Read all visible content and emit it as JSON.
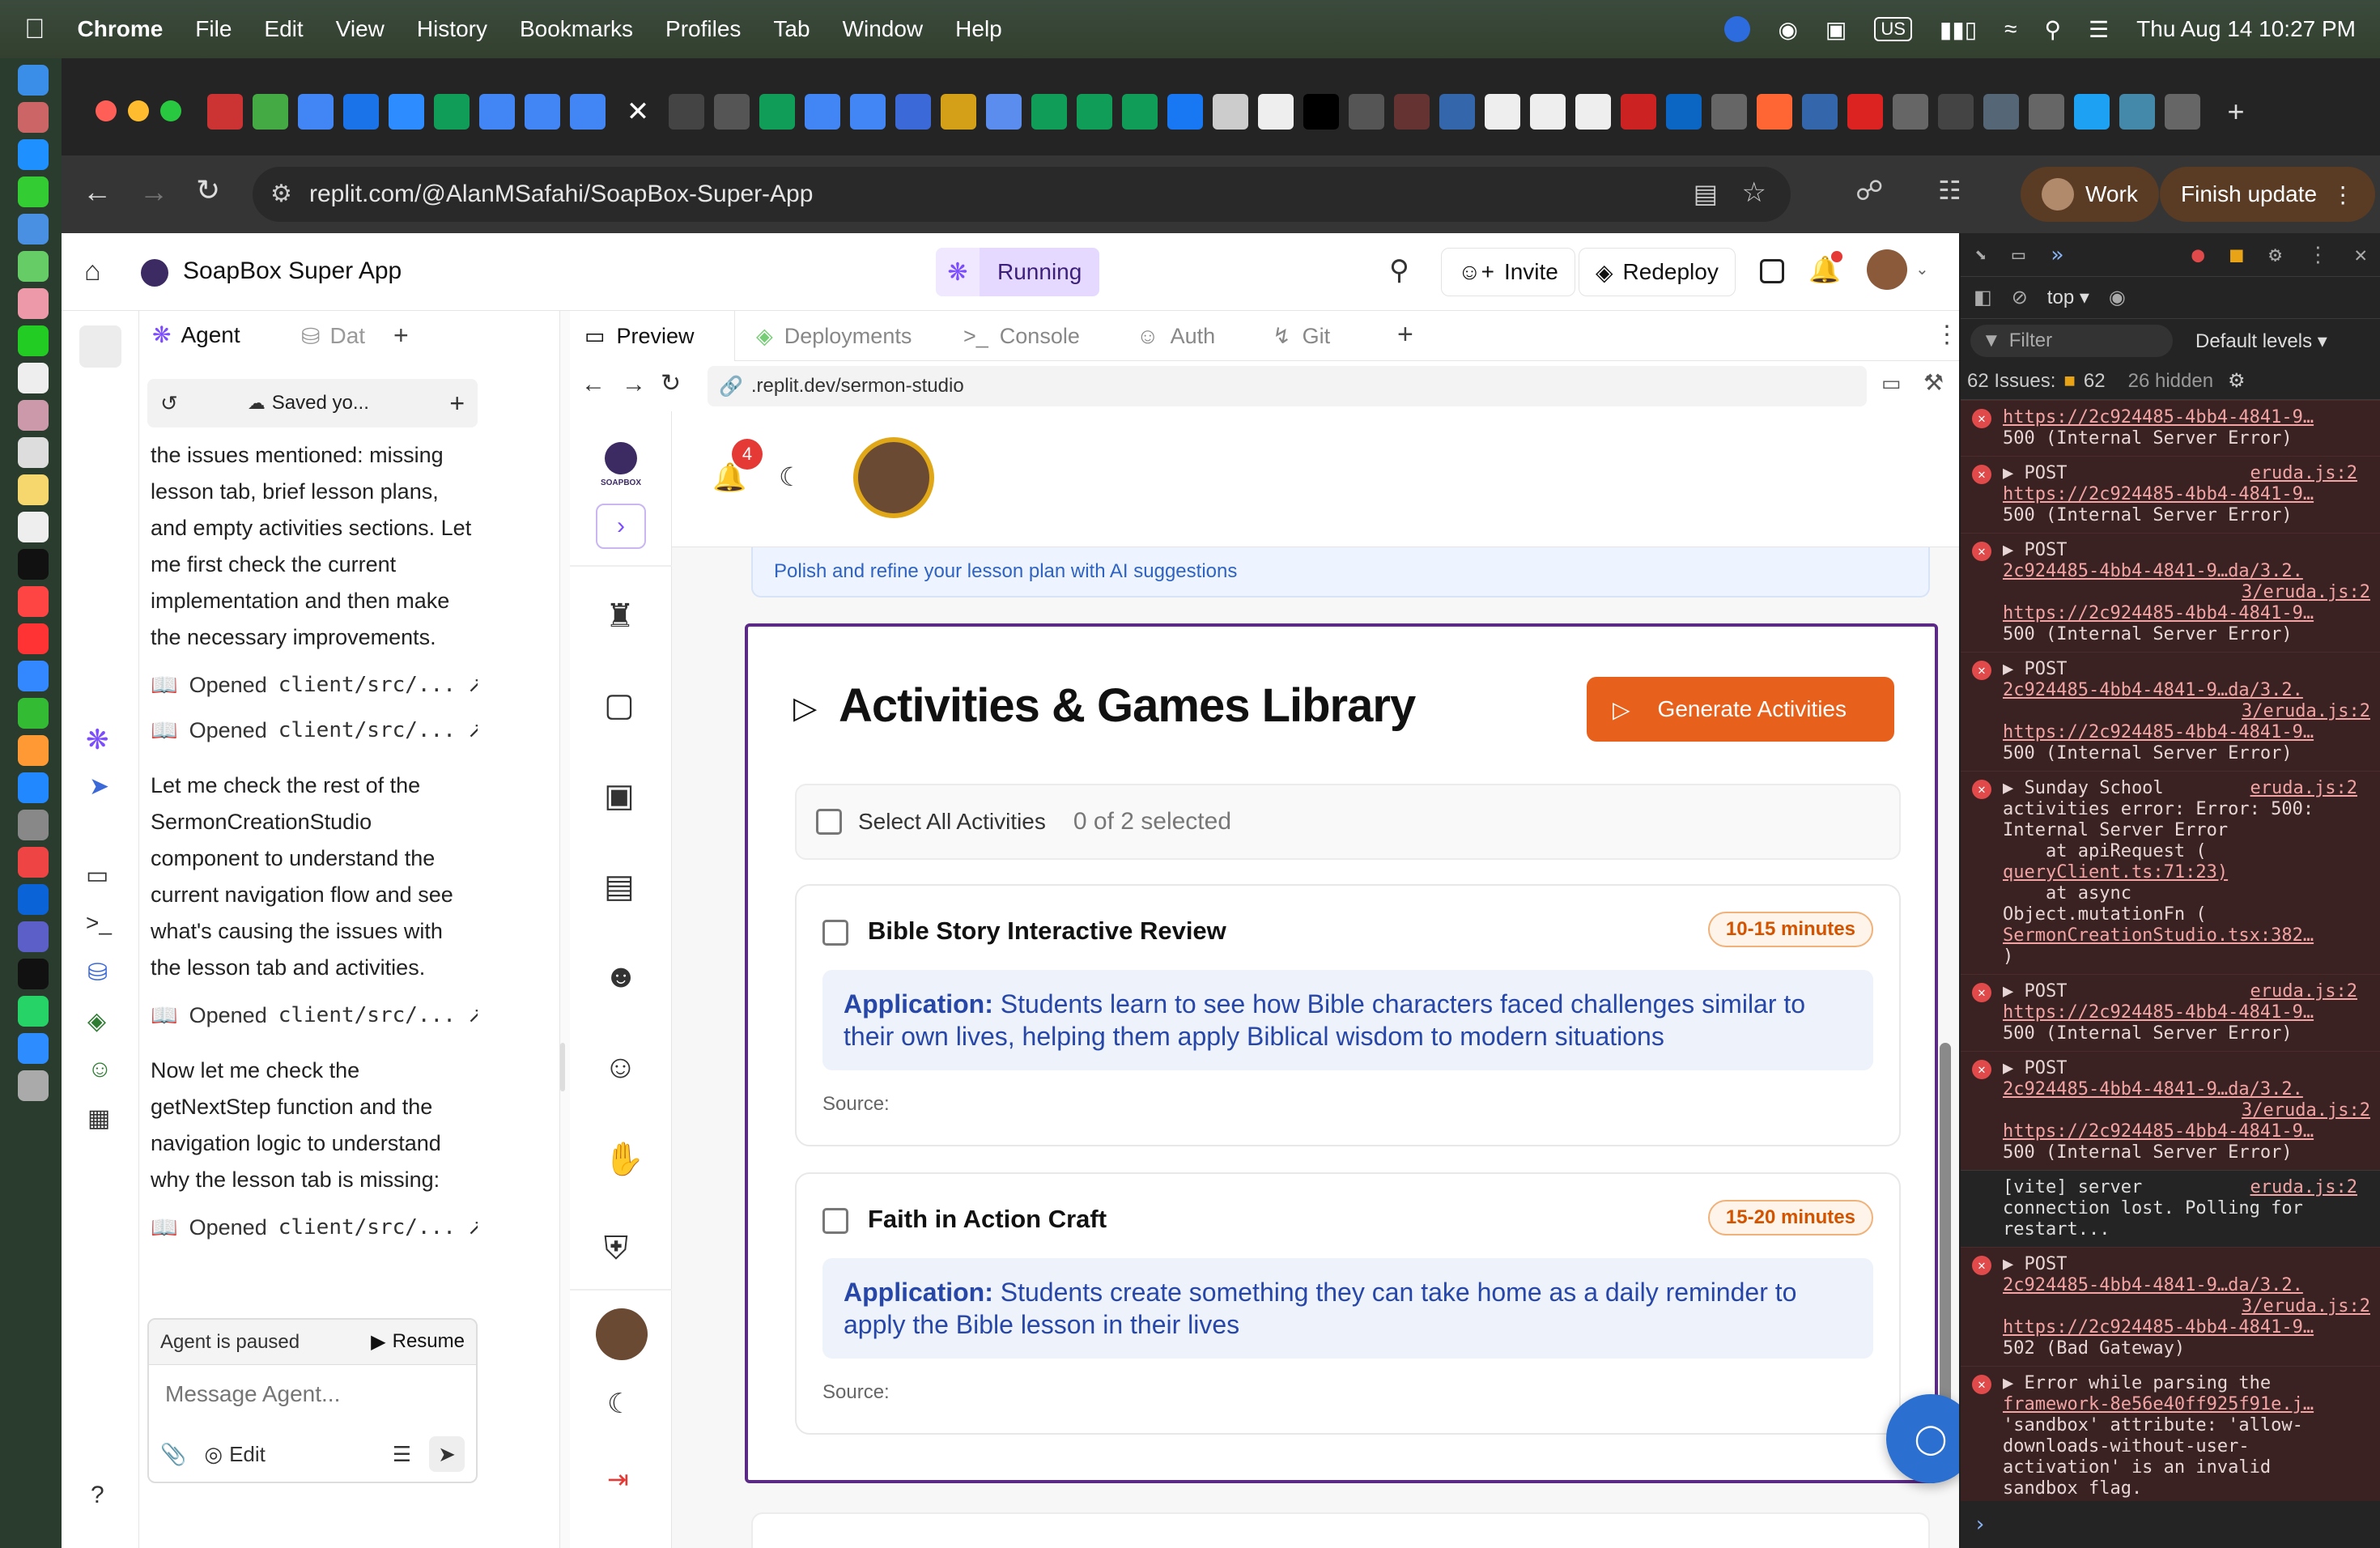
{
  "menubar": {
    "app": "Chrome",
    "items": [
      "File",
      "Edit",
      "View",
      "History",
      "Bookmarks",
      "Profiles",
      "Tab",
      "Window",
      "Help"
    ],
    "keyboard": "US",
    "datetime": "Thu Aug 14  10:27 PM"
  },
  "browser": {
    "url": "replit.com/@AlanMSafahi/SoapBox-Super-App",
    "profile_label": "Work",
    "finish_update_label": "Finish update"
  },
  "replit": {
    "project_name": "SoapBox Super App",
    "status": "Running",
    "invite_label": "Invite",
    "redeploy_label": "Redeploy"
  },
  "agent": {
    "tab_agent": "Agent",
    "tab_data": "Dat",
    "saved_label": "Saved yo...",
    "messages": [
      {
        "type": "text",
        "text": "the issues mentioned: missing lesson tab, brief lesson plans, and empty activities sections. Let me first check the current implementation and then make the necessary improvements."
      },
      {
        "type": "opened",
        "text": "client/src/..."
      },
      {
        "type": "opened",
        "text": "client/src/..."
      },
      {
        "type": "text",
        "text": "Let me check the rest of the SermonCreationStudio component to understand the current navigation flow and see what's causing the issues with the lesson tab and activities."
      },
      {
        "type": "opened",
        "text": "client/src/..."
      },
      {
        "type": "text",
        "text": "Now let me check the getNextStep function and the navigation logic to understand why the lesson tab is missing:"
      },
      {
        "type": "opened",
        "text": "client/src/..."
      }
    ],
    "opened_prefix": "Opened",
    "paused_label": "Agent is paused",
    "resume_label": "Resume",
    "input_placeholder": "Message Agent...",
    "edit_label": "Edit"
  },
  "workspace": {
    "tabs": [
      "Preview",
      "Deployments",
      "Console",
      "Auth",
      "Git"
    ],
    "preview_url": ".replit.dev/sermon-studio"
  },
  "app": {
    "logo_text": "SOAPBOX",
    "notif_count": "4",
    "refine_text": "Polish and refine your lesson plan with AI suggestions",
    "section_title": "Activities & Games Library",
    "generate_label": "Generate Activities",
    "select_all_label": "Select All Activities",
    "selected_count": "0 of 2 selected",
    "activities": [
      {
        "title": "Bible Story Interactive Review",
        "duration": "10-15 minutes",
        "application_label": "Application:",
        "application": "Students learn to see how Bible characters faced challenges similar to their own lives, helping them apply Biblical wisdom to modern situations",
        "source_label": "Source:"
      },
      {
        "title": "Faith in Action Craft",
        "duration": "15-20 minutes",
        "application_label": "Application:",
        "application": "Students create something they can take home as a daily reminder to apply the Bible lesson in their lives",
        "source_label": "Source:"
      }
    ]
  },
  "devtools": {
    "context": "top",
    "filter_placeholder": "Filter",
    "levels": "Default levels",
    "issues_label": "62 Issues:",
    "issues_count": "62",
    "hidden": "26 hidden",
    "logs": [
      {
        "kind": "error",
        "lines": [
          "https://2c924485-4bb4-4841-9…",
          "500 (Internal Server Error)"
        ],
        "head": "",
        "src": ""
      },
      {
        "kind": "error",
        "head": "▶ POST",
        "src": "eruda.js:2",
        "lines": [
          "https://2c924485-4bb4-4841-9…",
          "500 (Internal Server Error)"
        ]
      },
      {
        "kind": "error",
        "head": "▶ POST",
        "src": "",
        "lines": [
          "2c924485-4bb4-4841-9…da/3.2.",
          "3/eruda.js:2",
          "https://2c924485-4bb4-4841-9…",
          "500 (Internal Server Error)"
        ]
      },
      {
        "kind": "error",
        "head": "▶ POST",
        "src": "",
        "lines": [
          "2c924485-4bb4-4841-9…da/3.2.",
          "3/eruda.js:2",
          "https://2c924485-4bb4-4841-9…",
          "500 (Internal Server Error)"
        ]
      },
      {
        "kind": "error",
        "head": "▶ Sunday School",
        "src": "eruda.js:2",
        "lines": [
          "activities error: Error: 500:",
          "Internal Server Error",
          "    at apiRequest (",
          "queryClient.ts:71:23)",
          "    at async",
          "Object.mutationFn (",
          "SermonCreationStudio.tsx:382…",
          ")"
        ]
      },
      {
        "kind": "error",
        "head": "▶ POST",
        "src": "eruda.js:2",
        "lines": [
          "https://2c924485-4bb4-4841-9…",
          "500 (Internal Server Error)"
        ]
      },
      {
        "kind": "error",
        "head": "▶ POST",
        "src": "",
        "lines": [
          "2c924485-4bb4-4841-9…da/3.2.",
          "3/eruda.js:2",
          "https://2c924485-4bb4-4841-9…",
          "500 (Internal Server Error)"
        ]
      },
      {
        "kind": "info",
        "head": "[vite] server",
        "src": "eruda.js:2",
        "lines": [
          "connection lost. Polling for",
          "restart..."
        ]
      },
      {
        "kind": "error",
        "head": "▶ POST",
        "src": "",
        "lines": [
          "2c924485-4bb4-4841-9…da/3.2.",
          "3/eruda.js:2",
          "https://2c924485-4bb4-4841-9…",
          "502 (Bad Gateway)"
        ]
      },
      {
        "kind": "error",
        "head": "▶ Error while parsing the",
        "src": "",
        "lines": [
          "framework-8e56e40ff925f91e.j…",
          "'sandbox' attribute: 'allow-",
          "downloads-without-user-",
          "activation' is an invalid",
          "sandbox flag."
        ]
      }
    ]
  },
  "colors": {
    "accent_orange": "#e8611c",
    "running_bg": "#e6d9ff",
    "app_border": "#5b2a86",
    "app_text_blue": "#2747a8"
  }
}
